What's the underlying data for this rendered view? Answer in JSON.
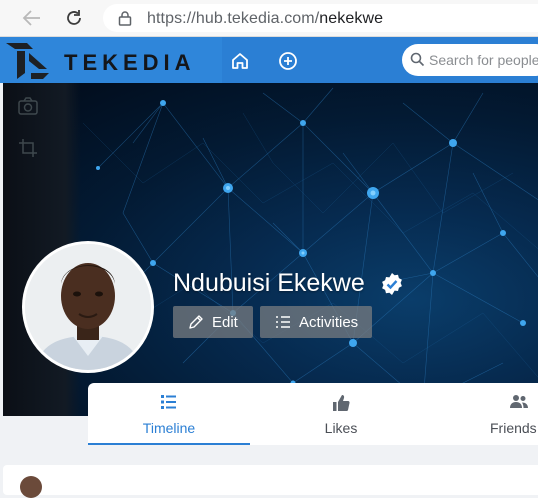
{
  "browser": {
    "url_host": "https://hub.tekedia.com/",
    "url_path": "nekekwe"
  },
  "site": {
    "logo_text": "TEKEDIA",
    "search_placeholder": "Search for people"
  },
  "profile": {
    "name": "Ndubuisi Ekekwe",
    "edit_label": "Edit",
    "activities_label": "Activities"
  },
  "tabs": [
    {
      "label": "Timeline",
      "icon": "timeline-icon",
      "active": true
    },
    {
      "label": "Likes",
      "icon": "thumbs-up-icon",
      "active": false
    },
    {
      "label": "Friends",
      "icon": "friends-icon",
      "active": false
    }
  ],
  "colors": {
    "brand": "#2b7fd4",
    "active_tab": "#2b7fd4"
  }
}
